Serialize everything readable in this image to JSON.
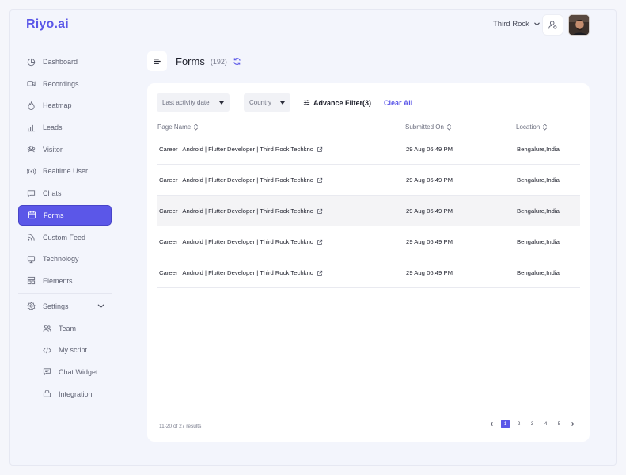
{
  "app": {
    "logo": "Riyo.ai"
  },
  "header": {
    "org_name": "Third Rock",
    "icons": {
      "org_dropdown": "chevron-down-icon",
      "user_settings": "user-gear-icon",
      "avatar": "user-avatar"
    }
  },
  "sidebar": {
    "items": [
      {
        "label": "Dashboard",
        "icon": "pie-chart-icon"
      },
      {
        "label": "Recordings",
        "icon": "video-camera-icon"
      },
      {
        "label": "Heatmap",
        "icon": "flame-icon"
      },
      {
        "label": "Leads",
        "icon": "bar-chart-icon"
      },
      {
        "label": "Visitor",
        "icon": "users-icon"
      },
      {
        "label": "Realtime User",
        "icon": "broadcast-icon"
      },
      {
        "label": "Chats",
        "icon": "chat-bubble-icon"
      },
      {
        "label": "Forms",
        "icon": "calendar-form-icon",
        "active": true
      },
      {
        "label": "Custom Feed",
        "icon": "rss-feed-icon"
      },
      {
        "label": "Technology",
        "icon": "monitor-icon"
      },
      {
        "label": "Elements",
        "icon": "layout-grid-icon"
      }
    ],
    "settings": {
      "label": "Settings",
      "icon": "gear-icon"
    },
    "sub_items": [
      {
        "label": "Team",
        "icon": "team-icon"
      },
      {
        "label": "My script",
        "icon": "code-icon"
      },
      {
        "label": "Chat Widget",
        "icon": "chat-widget-icon"
      },
      {
        "label": "Integration",
        "icon": "integration-icon"
      }
    ]
  },
  "page": {
    "title": "Forms",
    "count": "(192)"
  },
  "filters": {
    "date_select": "Last activity date",
    "country_select": "Country",
    "advance_filter": "Advance Filter(3)",
    "clear_all": "Clear All"
  },
  "table": {
    "columns": [
      "Page Name",
      "Submitted On",
      "Location"
    ],
    "rows": [
      {
        "page": "Career | Android | Flutter Developer | Third Rock Techkno",
        "submitted": "29 Aug 06:49 PM",
        "location": "Bengalure,India"
      },
      {
        "page": "Career | Android | Flutter Developer | Third Rock Techkno",
        "submitted": "29 Aug 06:49 PM",
        "location": "Bengalure,India"
      },
      {
        "page": "Career | Android | Flutter Developer | Third Rock Techkno",
        "submitted": "29 Aug 06:49 PM",
        "location": "Bengalure,India",
        "highlighted": true
      },
      {
        "page": "Career | Android | Flutter Developer | Third Rock Techkno",
        "submitted": "29 Aug 06:49 PM",
        "location": "Bengalure,India"
      },
      {
        "page": "Career | Android | Flutter Developer | Third Rock Techkno",
        "submitted": "29 Aug 06:49 PM",
        "location": "Bengalure,India"
      }
    ]
  },
  "pagination": {
    "results_text": "11-20 of 27 results",
    "pages": [
      "1",
      "2",
      "3",
      "4",
      "5"
    ],
    "current": "1"
  },
  "colors": {
    "accent": "#5b57e8",
    "background": "#f3f5fc",
    "card": "#ffffff"
  }
}
